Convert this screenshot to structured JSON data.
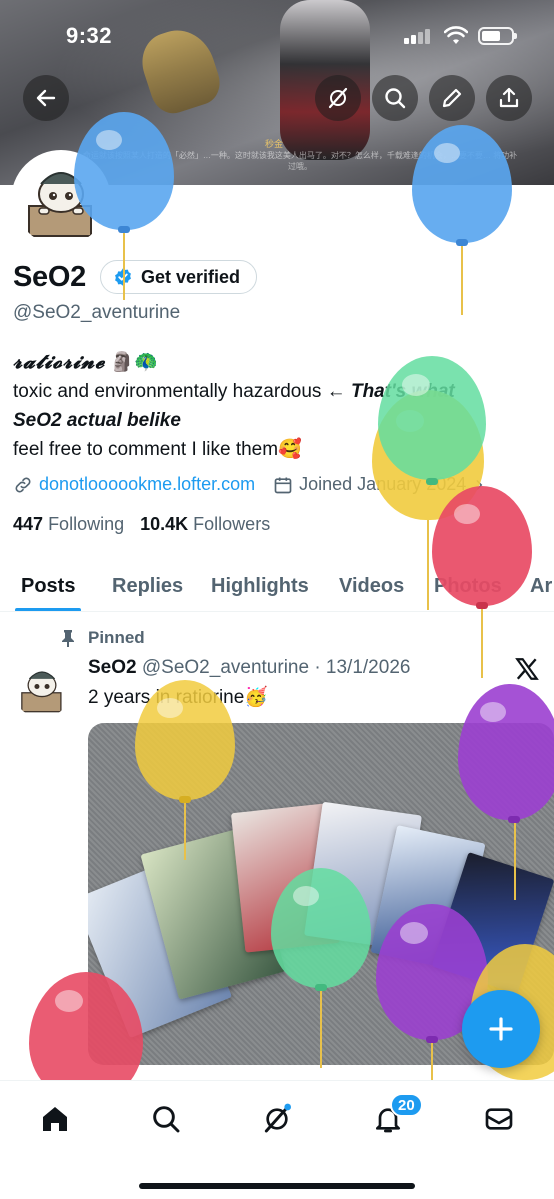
{
  "status_bar": {
    "time": "9:32"
  },
  "banner": {
    "subtitle_top": "秒金",
    "subtitle": "命运就该按照某人打造的「必然」…一种。这时就该我这美人出马了。对不？怎么样，千载难逢的机会，…要不要… 将功补过哦。"
  },
  "profile": {
    "display_name": "SeO2",
    "get_verified_label": "Get verified",
    "handle": "@SeO2_aventurine",
    "bio_line1_fancy": "𝓻𝓪𝓽𝓲𝓸𝓻𝓲𝓷𝓮",
    "bio_line1_emoji": "🗿🦚",
    "bio_line2": "toxic and environmentally hazardous ← ",
    "bio_line2_bold": "That's what",
    "bio_line3": "SeO2 actual belike",
    "bio_line4": "feel free to comment I like them🥰",
    "link": "donotloooookme.lofter.com",
    "joined": "Joined January 2024",
    "following_count": "447",
    "following_label": "Following",
    "followers_count": "10.4K",
    "followers_label": "Followers"
  },
  "tabs": [
    {
      "label": "Posts",
      "active": true
    },
    {
      "label": "Replies"
    },
    {
      "label": "Highlights"
    },
    {
      "label": "Videos"
    },
    {
      "label": "Photos"
    },
    {
      "label": "Ar"
    }
  ],
  "post": {
    "pinned_label": "Pinned",
    "author_name": "SeO2",
    "author_handle_date": "@SeO2_aventurine · 13/1/2026",
    "text": "2 years in ratiorine🥳"
  },
  "bottom_nav": {
    "notifications_badge": "20"
  },
  "colors": {
    "accent": "#1d9bf0",
    "balloon_blue": "#5aa6ef",
    "balloon_green": "#63dda0",
    "balloon_yellow": "#f1cb3e",
    "balloon_red": "#e84a64",
    "balloon_purple": "#9b3fd0"
  }
}
